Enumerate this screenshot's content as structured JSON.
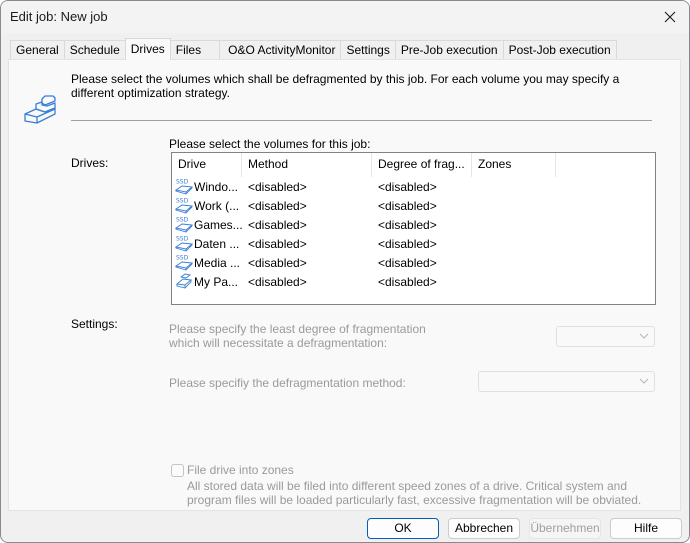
{
  "window": {
    "title": "Edit job: New job",
    "close_icon": "close-icon"
  },
  "tabs": [
    {
      "label": "General",
      "active": false
    },
    {
      "label": "Schedule",
      "active": false
    },
    {
      "label": "Drives",
      "active": true
    },
    {
      "label": "Files",
      "active": false
    },
    {
      "label": "O&O ActivityMonitor",
      "active": false
    },
    {
      "label": "Settings",
      "active": false
    },
    {
      "label": "Pre-Job execution",
      "active": false
    },
    {
      "label": "Post-Job execution",
      "active": false
    }
  ],
  "drives_page": {
    "header_icon": "stacked-drives-icon",
    "intro": "Please select the volumes which shall be defragmented by this job. For each volume you may specify a different optimization strategy.",
    "drives_label": "Drives:",
    "volumes_caption": "Please select the volumes for this job:",
    "columns": [
      "Drive",
      "Method",
      "Degree of frag...",
      "Zones"
    ],
    "rows": [
      {
        "icon": "ssd-drive-icon",
        "drive": "Windo...",
        "method": "<disabled>",
        "degree": "<disabled>",
        "zones": ""
      },
      {
        "icon": "ssd-drive-icon",
        "drive": "Work (...",
        "method": "<disabled>",
        "degree": "<disabled>",
        "zones": ""
      },
      {
        "icon": "ssd-drive-icon",
        "drive": "Games...",
        "method": "<disabled>",
        "degree": "<disabled>",
        "zones": ""
      },
      {
        "icon": "ssd-drive-icon",
        "drive": "Daten ...",
        "method": "<disabled>",
        "degree": "<disabled>",
        "zones": ""
      },
      {
        "icon": "ssd-drive-icon",
        "drive": "Media ...",
        "method": "<disabled>",
        "degree": "<disabled>",
        "zones": ""
      },
      {
        "icon": "network-drive-icon",
        "drive": "My Pa...",
        "method": "<disabled>",
        "degree": "<disabled>",
        "zones": ""
      }
    ],
    "settings_label": "Settings:",
    "degree_prompt": "Please specify the least degree of fragmentation which will necessitate a defragmentation:",
    "degree_value": "",
    "method_prompt": "Please specifiy the defragmentation method:",
    "method_value": "",
    "zones_checkbox": {
      "label": "File drive into zones",
      "checked": false,
      "description": "All stored data will be filed into different speed zones of a drive. Critical system and program files will be loaded particularly fast, excessive fragmentation will be obviated."
    }
  },
  "buttons": {
    "ok": "OK",
    "cancel": "Abbrechen",
    "apply": "Übernehmen",
    "help": "Hilfe"
  },
  "colors": {
    "accent": "#005fb8",
    "icon_blue": "#3a7fd5",
    "disabled_text": "#9a9a9a"
  }
}
